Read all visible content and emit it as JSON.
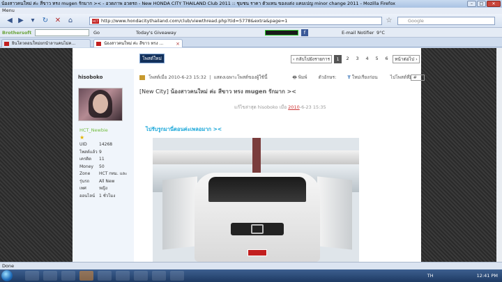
{
  "window": {
    "title": "น้องสาวคนใหม่ ค่ะ สีขาว ทรง mugen รักมาก >< - อวดภาพ อวดรถ - New HONDA CITY THAILAND Club 2011 :: ชุมชน ราคา ตัวแทน ของแต่ง แคมเปญ minor change 2011 - Mozilla Firefox",
    "controls": [
      "–",
      "□",
      "✕"
    ]
  },
  "menubar": {
    "label": "Menu"
  },
  "navbar": {
    "url": "http://www.hondacitythailand.com/club/viewthread.php?tid=5778&extra&page=1",
    "search_placeholder": "Google"
  },
  "toolbar2": {
    "brand": "Brothersoft",
    "go": "Go",
    "giveaway": "Today's Giveaway",
    "email": "E-mail Notifier",
    "weather": "9°C"
  },
  "tabs": [
    {
      "label": "ยินโดวตอนใหม่ยกนำลานคนไม่ค...",
      "close": "×"
    },
    {
      "label": "น้องสาวคนใหม่ ค่ะ สีขาว ทรง ...",
      "close": "×"
    }
  ],
  "forum": {
    "new_button": "โพสต์ใหม่",
    "pager": {
      "back": "‹ กลับไปยังรายการ",
      "pages": [
        "1",
        "2",
        "3",
        "4",
        "5",
        "6"
      ],
      "current": "1",
      "next": "หน้าต่อไป ›"
    },
    "author": {
      "username": "hisoboko",
      "rank": "HCT_Newbie",
      "star": "★",
      "stats": [
        {
          "k": "UID",
          "v": "14268"
        },
        {
          "k": "โพสต์แล้ว",
          "v": "9"
        },
        {
          "k": "เครดิต",
          "v": "11"
        },
        {
          "k": "Money",
          "v": "50"
        },
        {
          "k": "Zone",
          "v": "HCT กทม. และ"
        },
        {
          "k": "รุ่นรถ",
          "v": "All New"
        },
        {
          "k": "เพศ",
          "v": "หญิง"
        },
        {
          "k": "ออนไลน์",
          "v": "1 ชั่วโมง"
        }
      ]
    },
    "post": {
      "posted_at": "โพสต์เมื่อ 2010-6-23 15:32",
      "only_author": "แสดงเฉพาะโพสต์ของผู้ใช้นี้",
      "print": "พิมพ์",
      "font_size": "ตัวอักษร:",
      "order": "ใหม่เรียงก่อน",
      "goto": "ไปโพสต์ที่",
      "floor": "1 #",
      "subject_tag": "[New City]",
      "subject": "น้องสาวคนใหม่ ค่ะ สีขาว ทรง mugen รักมาก ><",
      "edit_prefix": "แก้ไขล่าสุด hisoboko เมื่อ ",
      "edit_year": "2010",
      "edit_rest": "-6-23 15:35",
      "link_text": "ไปรับรูกมานี่ตอนค่ะเพลอมาก ><"
    }
  },
  "statusbar": {
    "text": "Done"
  },
  "taskbar": {
    "lang": "TH",
    "time": "12:41 PM"
  }
}
